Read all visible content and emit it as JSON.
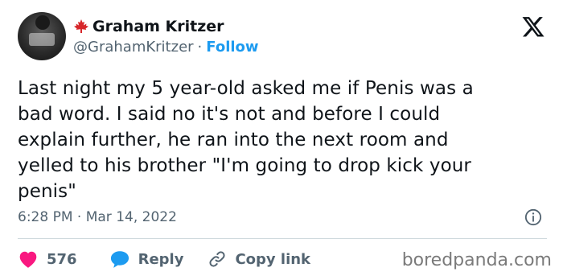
{
  "author": {
    "name": "Graham Kritzer",
    "handle": "@GrahamKritzer",
    "separator": "·",
    "follow_label": "Follow",
    "flag_icon": "maple-leaf-icon",
    "leaf_color": "#d7262a"
  },
  "tweet": {
    "text": "Last night my 5 year-old asked me if Penis was a\nbad word. I said no it's not and before I could\nexplain further, he ran into the next room and\nyelled to his brother \"I'm going to drop kick your\npenis\""
  },
  "timestamp": "6:28 PM · Mar 14, 2022",
  "actions": {
    "like_count": "576",
    "reply_label": "Reply",
    "copy_link_label": "Copy link"
  },
  "watermark": "boredpanda.com",
  "colors": {
    "like": "#f91880",
    "reply": "#1d9bf0",
    "secondary_text": "#536471",
    "follow": "#1d9bf0"
  }
}
